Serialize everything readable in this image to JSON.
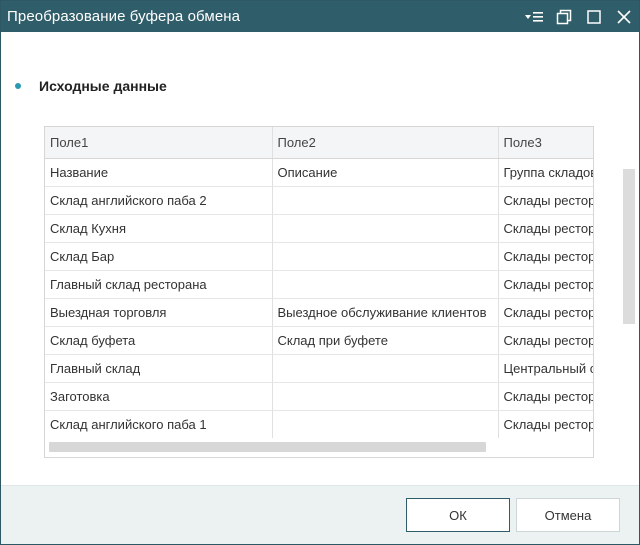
{
  "window": {
    "title": "Преобразование буфера обмена"
  },
  "section": {
    "title": "Исходные данные"
  },
  "grid": {
    "columns": [
      "Поле1",
      "Поле2",
      "Поле3"
    ],
    "rows": [
      [
        "Название",
        "Описание",
        "Группа складов"
      ],
      [
        "Склад английского паба 2",
        "",
        "Склады ресторана"
      ],
      [
        "Склад Кухня",
        "",
        "Склады ресторана"
      ],
      [
        "Склад Бар",
        "",
        "Склады ресторана"
      ],
      [
        "Главный склад ресторана",
        "",
        "Склады ресторана"
      ],
      [
        "Выездная торговля",
        "Выездное обслуживание клиентов",
        "Склады ресторана"
      ],
      [
        "Склад буфета",
        "Склад при буфете",
        "Склады ресторана"
      ],
      [
        "Главный склад",
        "",
        "Центральный склад"
      ],
      [
        "Заготовка",
        "",
        "Склады ресторана"
      ],
      [
        "Склад английского паба 1",
        "",
        "Склады ресторана"
      ]
    ]
  },
  "footer": {
    "ok_label": "ОК",
    "cancel_label": "Отмена"
  },
  "icons": {
    "menu": "menu-lines-icon",
    "restore": "restore-icon",
    "maximize": "maximize-icon",
    "close": "close-icon"
  },
  "colors": {
    "titlebar": "#2f5d69",
    "accent": "#2a9ab0",
    "footer": "#ecf1f2"
  }
}
